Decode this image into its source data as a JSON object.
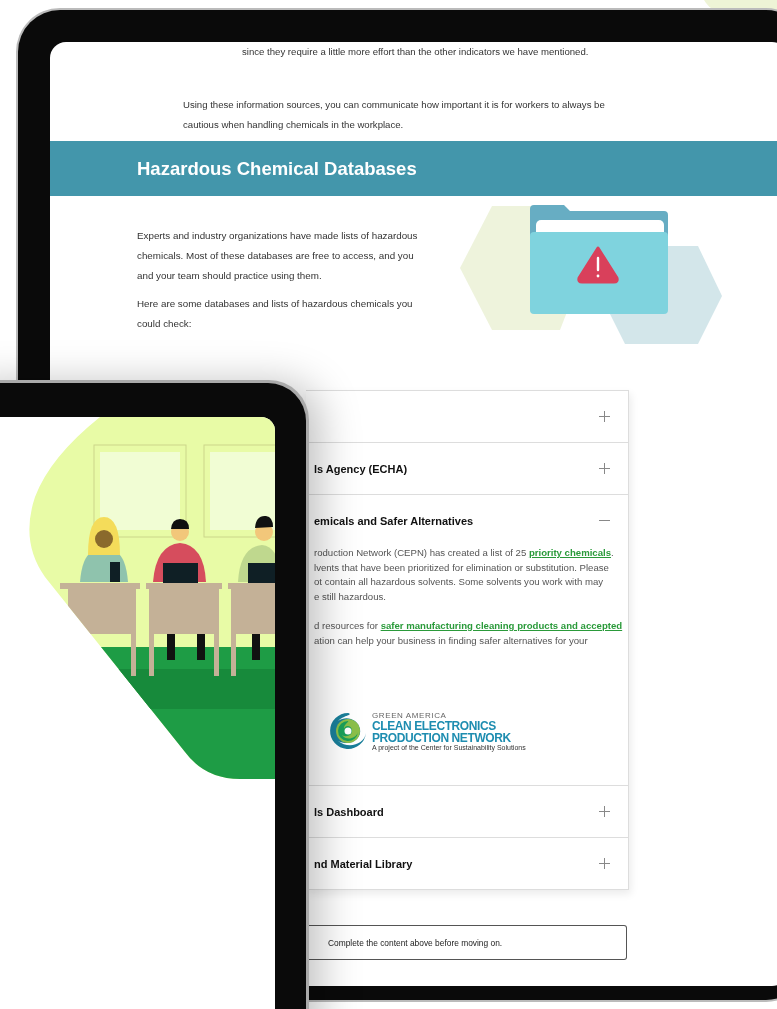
{
  "page": {
    "lead_text": "since they require a little more effort than the other indicators we have mentioned.",
    "intro_text": "Using these information sources, you can communicate how important it is for workers to always be cautious when handling chemicals in the workplace.",
    "section_title": "Hazardous Chemical Databases",
    "paragraphs": [
      "Experts and industry organizations have made lists of hazardous chemicals. Most of these databases are free to access, and you and your team should practice using them.",
      "Here are some databases and lists of hazardous chemicals you could check:"
    ]
  },
  "accordion": [
    {
      "expanded": false
    },
    {
      "title": "ls Agency (ECHA)",
      "expanded": false
    },
    {
      "title": "emicals and Safer Alternatives",
      "expanded": true,
      "content": {
        "paragraphs": [
          [
            [
              {
                "text": "roduction Network (CEPN) has created a list of 25 "
              },
              {
                "text": "priority chemicals",
                "link": true
              },
              {
                "text": "."
              }
            ],
            [
              {
                "text": "lvents that have been prioritized for elimination or substitution. Please"
              }
            ],
            [
              {
                "text": "ot contain all hazardous solvents. Some solvents you work with may"
              }
            ],
            [
              {
                "text": "e still hazardous."
              }
            ]
          ],
          [
            [
              {
                "text": "d resources for "
              },
              {
                "text": "safer manufacturing cleaning products and accepted",
                "link": true
              }
            ],
            [
              {
                "text": "ation can help your business in finding safer alternatives for your"
              }
            ]
          ]
        ],
        "logo": {
          "org": "GREEN AMERICA",
          "name_lines": [
            "CLEAN ELECTRONICS",
            "PRODUCTION NETWORK"
          ],
          "tagline": "A project of the Center for Sustainability Solutions"
        }
      }
    },
    {
      "title": "ls Dashboard",
      "expanded": false
    },
    {
      "title": "nd Material Library",
      "expanded": false
    }
  ],
  "notice": "Complete the content above before moving on."
}
